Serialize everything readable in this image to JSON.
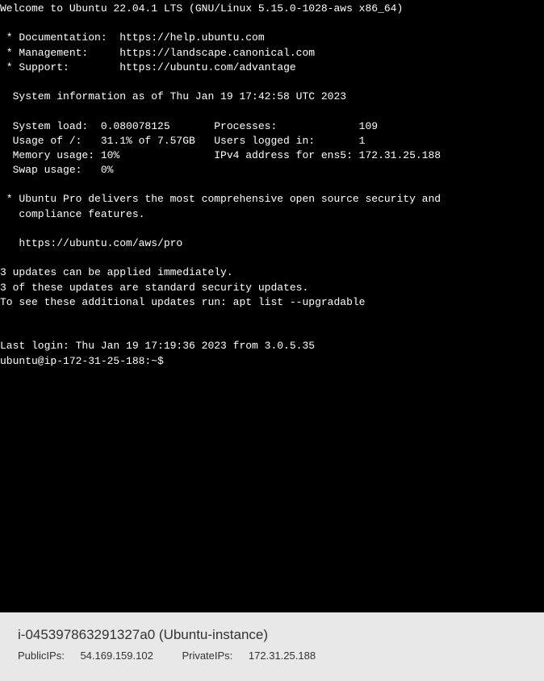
{
  "terminal": {
    "welcome": "Welcome to Ubuntu 22.04.1 LTS (GNU/Linux 5.15.0-1028-aws x86_64)",
    "links": {
      "doc_label": " * Documentation:  ",
      "doc_url": "https://help.ubuntu.com",
      "mgmt_label": " * Management:     ",
      "mgmt_url": "https://landscape.canonical.com",
      "support_label": " * Support:        ",
      "support_url": "https://ubuntu.com/advantage"
    },
    "sysinfo_header": "  System information as of Thu Jan 19 17:42:58 UTC 2023",
    "stats": {
      "row1": "  System load:  0.080078125       Processes:             109",
      "row2": "  Usage of /:   31.1% of 7.57GB   Users logged in:       1",
      "row3": "  Memory usage: 10%               IPv4 address for ens5: 172.31.25.188",
      "row4": "  Swap usage:   0%"
    },
    "pro_msg1": " * Ubuntu Pro delivers the most comprehensive open source security and",
    "pro_msg2": "   compliance features.",
    "pro_url": "   https://ubuntu.com/aws/pro",
    "updates1": "3 updates can be applied immediately.",
    "updates2": "3 of these updates are standard security updates.",
    "updates3": "To see these additional updates run: apt list --upgradable",
    "last_login": "Last login: Thu Jan 19 17:19:36 2023 from 3.0.5.35",
    "prompt": "ubuntu@ip-172-31-25-188:~$ "
  },
  "footer": {
    "instance_id": "i-045397863291327a0",
    "instance_name": "(Ubuntu-instance)",
    "public_label": "PublicIPs:",
    "public_ip": "54.169.159.102",
    "private_label": "PrivateIPs:",
    "private_ip": "172.31.25.188"
  }
}
